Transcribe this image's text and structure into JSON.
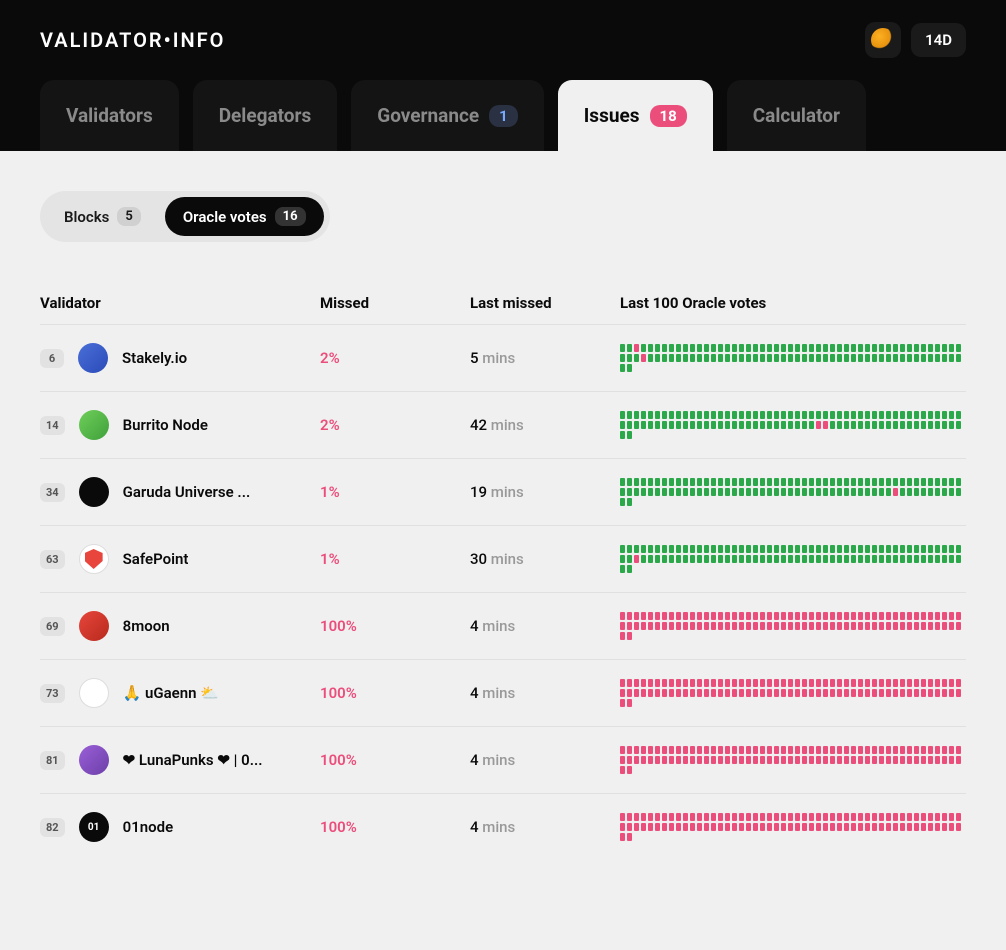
{
  "header": {
    "logo": "VALIDATOR•INFO",
    "time_badge": "14D"
  },
  "tabs": [
    {
      "label": "Validators",
      "badge": null,
      "active": false
    },
    {
      "label": "Delegators",
      "badge": null,
      "active": false
    },
    {
      "label": "Governance",
      "badge": "1",
      "badge_color": "blue",
      "active": false
    },
    {
      "label": "Issues",
      "badge": "18",
      "badge_color": "pink",
      "active": true
    },
    {
      "label": "Calculator",
      "badge": null,
      "active": false
    }
  ],
  "sub_tabs": [
    {
      "label": "Blocks",
      "badge": "5",
      "active": false
    },
    {
      "label": "Oracle votes",
      "badge": "16",
      "active": true
    }
  ],
  "columns": {
    "validator": "Validator",
    "missed": "Missed",
    "last_missed": "Last missed",
    "votes": "Last 100 Oracle votes"
  },
  "rows": [
    {
      "rank": "6",
      "name": "Stakely.io",
      "missed": "2%",
      "last_value": "5",
      "last_unit": "mins",
      "pattern": "low",
      "miss_positions": [
        2,
        52
      ]
    },
    {
      "rank": "14",
      "name": "Burrito Node",
      "missed": "2%",
      "last_value": "42",
      "last_unit": "mins",
      "pattern": "low",
      "miss_positions": [
        77,
        78
      ]
    },
    {
      "rank": "34",
      "name": "Garuda Universe ...",
      "missed": "1%",
      "last_value": "19",
      "last_unit": "mins",
      "pattern": "low",
      "miss_positions": [
        88
      ]
    },
    {
      "rank": "63",
      "name": "SafePoint",
      "missed": "1%",
      "last_value": "30",
      "last_unit": "mins",
      "pattern": "low",
      "miss_positions": [
        51
      ]
    },
    {
      "rank": "69",
      "name": "8moon",
      "missed": "100%",
      "last_value": "4",
      "last_unit": "mins",
      "pattern": "full"
    },
    {
      "rank": "73",
      "name": "🙏 uGaenn ⛅",
      "missed": "100%",
      "last_value": "4",
      "last_unit": "mins",
      "pattern": "full"
    },
    {
      "rank": "81",
      "name": "❤ LunaPunks ❤ | 0...",
      "missed": "100%",
      "last_value": "4",
      "last_unit": "mins",
      "pattern": "full"
    },
    {
      "rank": "82",
      "name": "01node",
      "missed": "100%",
      "last_value": "4",
      "last_unit": "mins",
      "pattern": "full"
    }
  ],
  "avatar_classes": [
    "av-blue",
    "av-green",
    "av-black",
    "av-safepoint",
    "av-red",
    "av-white",
    "av-purple",
    "av-01"
  ]
}
